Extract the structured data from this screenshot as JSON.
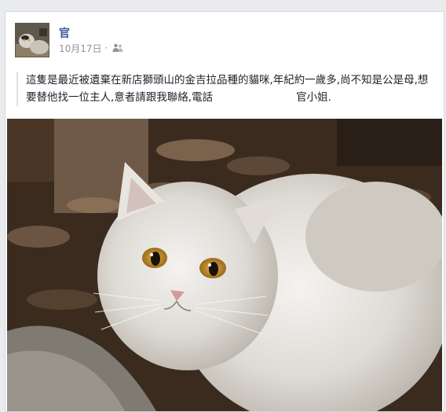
{
  "post": {
    "author": "官",
    "date": "10月17日",
    "audience_icon": "friends-icon",
    "text_before_redaction": "這隻是最近被遺棄在新店獅頭山的金吉拉品種的貓咪,年紀約一歲多,尚不知是公是母,想要替他找一位主人,意者請跟我聯絡,電話",
    "text_after_redaction": "官小姐."
  },
  "colors": {
    "author_link": "#3b5998",
    "meta_text": "#90949c",
    "card_border": "#d3d6db",
    "page_bg": "#e9ebee"
  }
}
